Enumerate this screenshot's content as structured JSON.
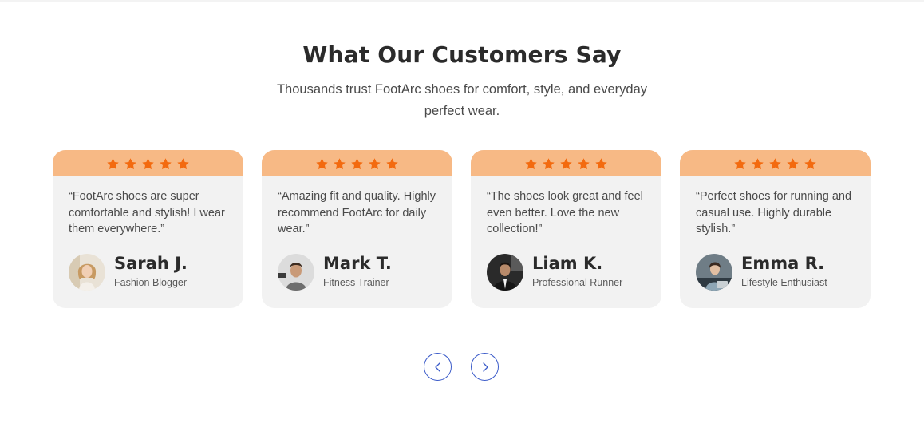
{
  "section": {
    "title": "What Our Customers Say",
    "subtitle": "Thousands trust FootArc shoes for comfort, style, and everyday perfect wear."
  },
  "colors": {
    "accent": "#f7b985",
    "star": "#f36a0f",
    "card_bg": "#f2f2f2",
    "nav_border": "#3b5bc9"
  },
  "testimonials": [
    {
      "rating": 5,
      "quote": "“FootArc shoes are super comfortable and stylish! I wear them everywhere.”",
      "name": "Sarah J.",
      "role": "Fashion Blogger",
      "avatar_icon": "woman-portrait"
    },
    {
      "rating": 5,
      "quote": "“Amazing fit and quality. Highly recommend FootArc for daily wear.”",
      "name": "Mark T.",
      "role": "Fitness Trainer",
      "avatar_icon": "man-portrait"
    },
    {
      "rating": 5,
      "quote": "“The shoes look great and feel even better. Love the new collection!”",
      "name": "Liam K.",
      "role": "Professional Runner",
      "avatar_icon": "man-suit-portrait"
    },
    {
      "rating": 5,
      "quote": "“Perfect shoes for running and casual use. Highly durable  stylish.”",
      "name": "Emma R.",
      "role": "Lifestyle Enthusiast",
      "avatar_icon": "woman-laptop-portrait"
    }
  ],
  "navigation": {
    "prev_icon": "chevron-left-icon",
    "next_icon": "chevron-right-icon"
  }
}
